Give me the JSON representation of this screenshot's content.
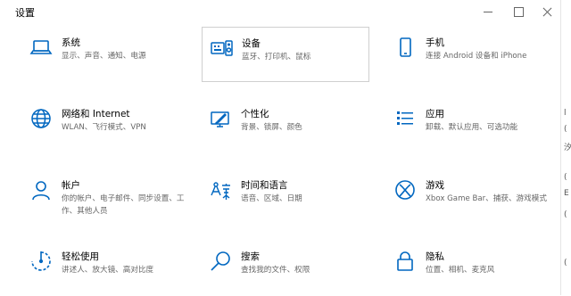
{
  "window": {
    "title": "设置"
  },
  "tiles": [
    {
      "name": "系统",
      "desc": "显示、声音、通知、电源",
      "icon": "laptop-icon"
    },
    {
      "name": "设备",
      "desc": "蓝牙、打印机、鼠标",
      "icon": "keyboard-speaker-icon"
    },
    {
      "name": "手机",
      "desc": "连接 Android 设备和 iPhone",
      "icon": "phone-icon"
    },
    {
      "name": "网络和 Internet",
      "desc": "WLAN、飞行模式、VPN",
      "icon": "globe-icon"
    },
    {
      "name": "个性化",
      "desc": "背景、锁屏、颜色",
      "icon": "paint-monitor-icon"
    },
    {
      "name": "应用",
      "desc": "卸载、默认应用、可选功能",
      "icon": "apps-list-icon"
    },
    {
      "name": "帐户",
      "desc": "你的帐户、电子邮件、同步设置、工作、其他人员",
      "icon": "person-icon"
    },
    {
      "name": "时间和语言",
      "desc": "语音、区域、日期",
      "icon": "time-language-icon"
    },
    {
      "name": "游戏",
      "desc": "Xbox Game Bar、捕获、游戏模式",
      "icon": "xbox-icon"
    },
    {
      "name": "轻松使用",
      "desc": "讲述人、放大镜、高对比度",
      "icon": "ease-of-access-icon"
    },
    {
      "name": "搜索",
      "desc": "查找我的文件、权限",
      "icon": "search-icon"
    },
    {
      "name": "隐私",
      "desc": "位置、相机、麦克风",
      "icon": "lock-icon"
    }
  ],
  "side_strip": [
    "l",
    "(",
    "汐",
    "(",
    "E",
    "(",
    "("
  ],
  "colors": {
    "accent": "#0067c0",
    "selected_border": "#cfcfcf"
  }
}
